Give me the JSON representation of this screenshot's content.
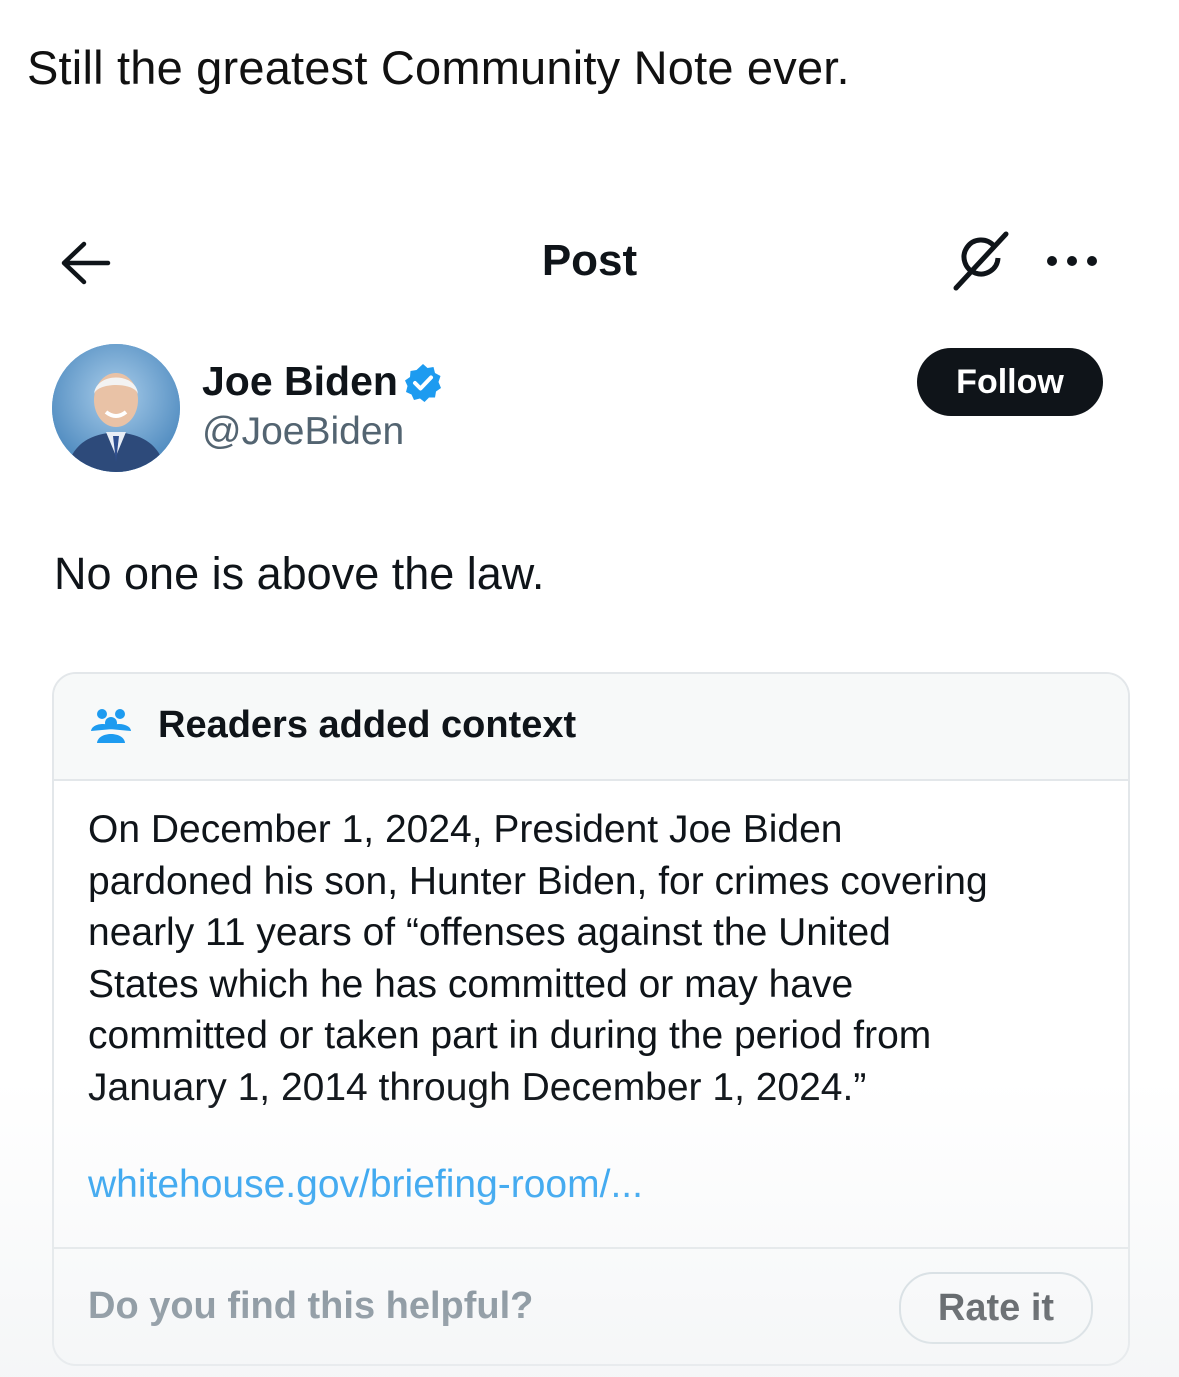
{
  "caption": "Still the greatest Community Note ever.",
  "topbar": {
    "title": "Post",
    "back_icon": "arrow-left-icon",
    "grok_icon": "grok-icon",
    "more_icon": "more-horizontal-icon"
  },
  "author": {
    "name": "Joe Biden",
    "handle": "@JoeBiden",
    "verified_icon": "verified-badge-icon",
    "follow_label": "Follow"
  },
  "post": {
    "text": "No one is above the law."
  },
  "note": {
    "icon": "readers-icon",
    "title": "Readers added context",
    "body_lines": [
      "On December 1, 2024, President Joe Biden",
      "pardoned his son, Hunter Biden, for crimes covering",
      "nearly 11 years of “offenses against the United",
      "States which he has committed or may have",
      "committed or taken part in during the period from",
      "January 1, 2014 through December 1, 2024.”"
    ],
    "link": "whitehouse.gov/briefing-room/...",
    "helpful_question": "Do you find this helpful?",
    "rate_label": "Rate it"
  },
  "colors": {
    "text": "#0f1419",
    "secondary": "#536471",
    "link": "#1d9bf0",
    "verified": "#1d9bf0",
    "button_dark": "#0f1419",
    "border": "#e3e7ea",
    "header_bg": "#f7f9f9"
  }
}
